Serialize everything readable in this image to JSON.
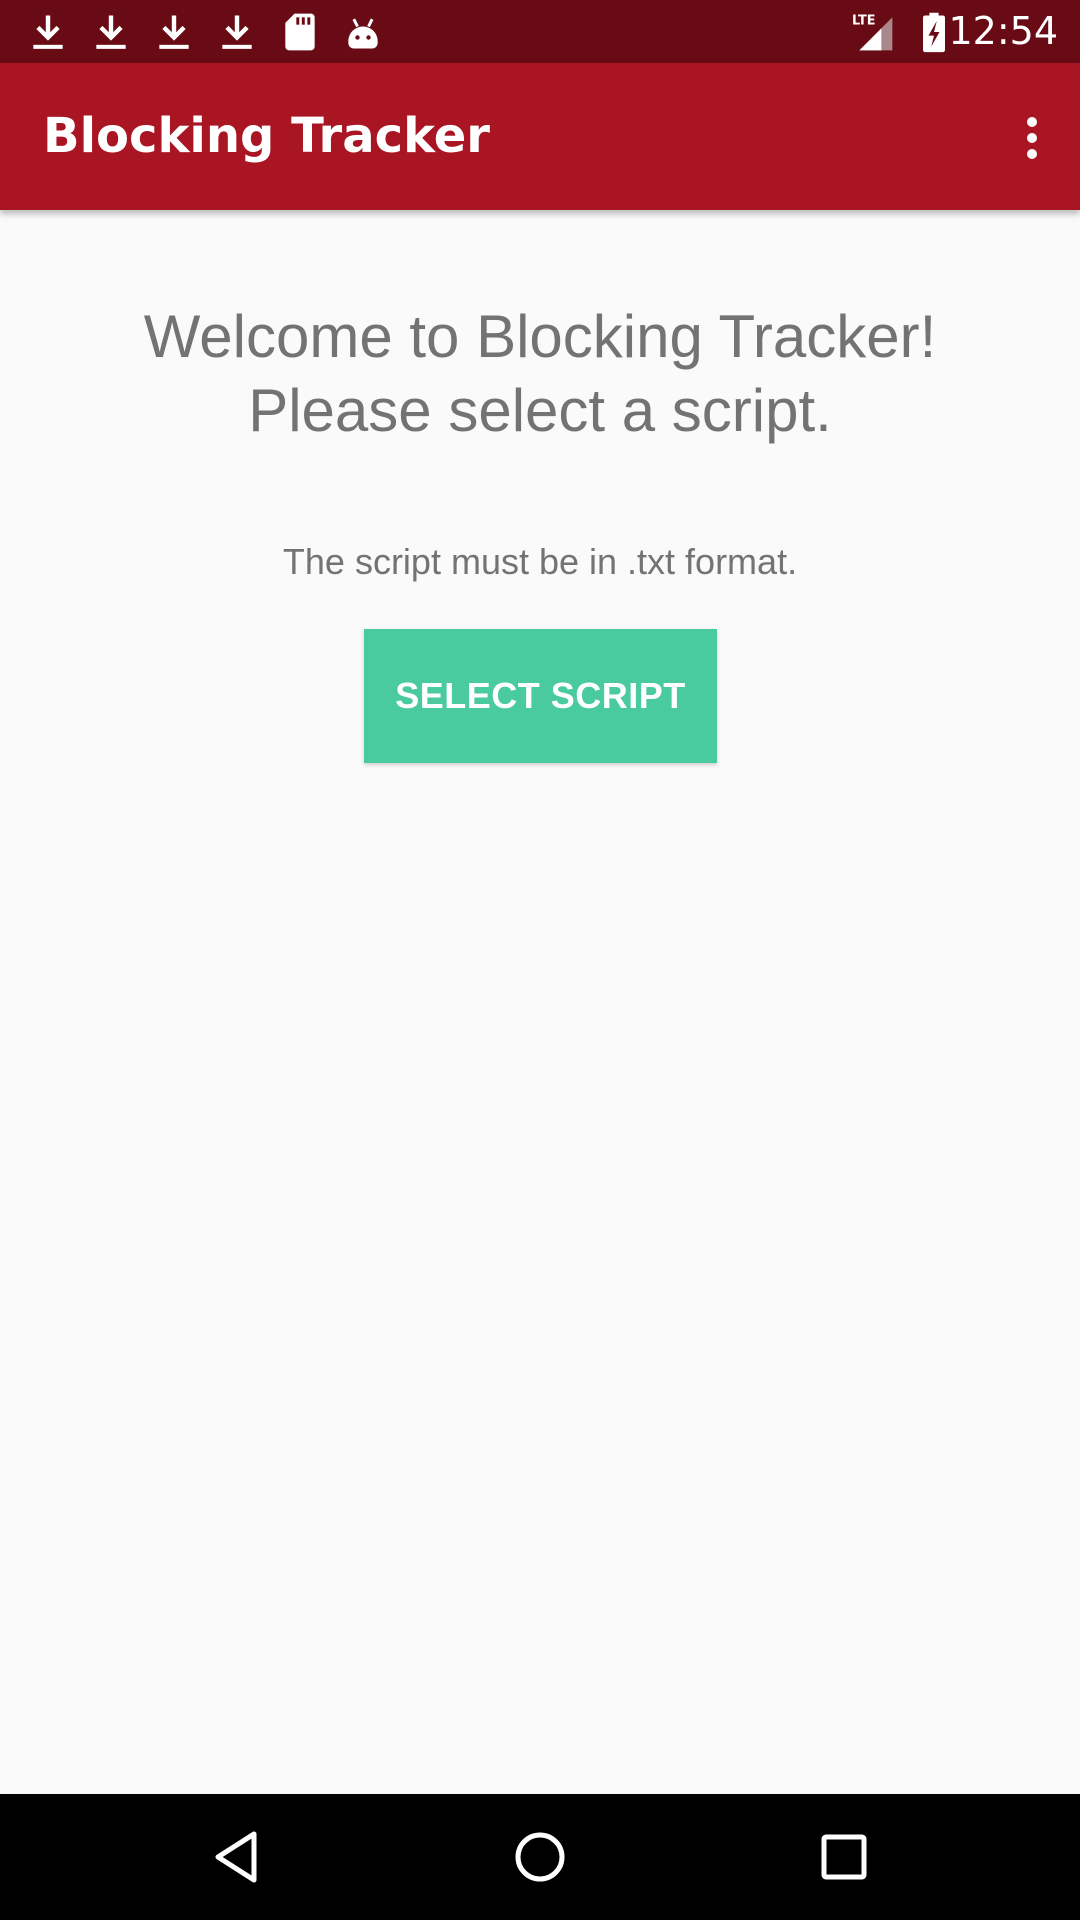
{
  "status_bar": {
    "time": "12:54",
    "network": "LTE",
    "icons": [
      "download-icon",
      "download-icon",
      "download-icon",
      "download-icon",
      "sd-card-icon",
      "android-icon",
      "lte-signal-icon",
      "battery-charging-icon"
    ]
  },
  "app_bar": {
    "title": "Blocking Tracker",
    "overflow_icon": "more-vertical-icon"
  },
  "main": {
    "welcome_line1": "Welcome to Blocking Tracker!",
    "welcome_line2": "Please select a script.",
    "hint": "The script must be in .txt format.",
    "select_button_label": "SELECT SCRIPT"
  },
  "nav_bar": {
    "back_icon": "back-triangle-icon",
    "home_icon": "home-circle-icon",
    "recents_icon": "recents-square-icon"
  },
  "colors": {
    "status_bar": "#690b15",
    "app_bar": "#a91522",
    "accent": "#4acb9f",
    "background": "#fafafa",
    "text_secondary": "#737373"
  }
}
